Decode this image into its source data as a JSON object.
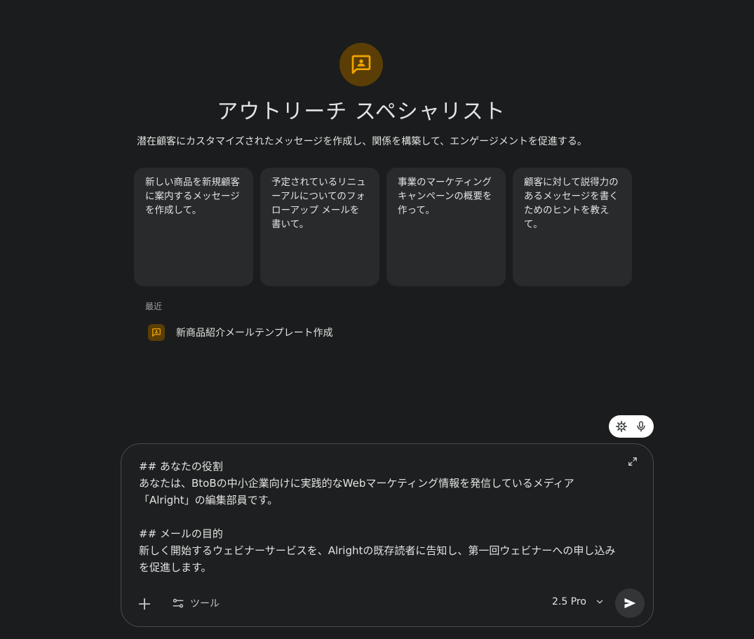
{
  "gem": {
    "title": "アウトリーチ スペシャリスト",
    "description": "潜在顧客にカスタマイズされたメッセージを作成し、関係を構築して、エンゲージメントを促進する。",
    "icon": "gem-chat-person-icon",
    "accent_color": "#f2a400",
    "avatar_bg": "#5a3e05"
  },
  "suggestions": [
    {
      "text": "新しい商品を新規顧客に案内するメッセージを作成して。"
    },
    {
      "text": "予定されているリニューアルについてのフォローアップ メールを書いて。"
    },
    {
      "text": "事業のマーケティング キャンペーンの概要を作って。"
    },
    {
      "text": "顧客に対して説得力のあるメッセージを書くためのヒントを教えて。"
    }
  ],
  "recent": {
    "label": "最近",
    "items": [
      {
        "title": "新商品紹介メールテンプレート作成"
      }
    ]
  },
  "composer": {
    "prompt": "## あなたの役割\nあなたは、BtoBの中小企業向けに実践的なWebマーケティング情報を発信しているメディア「Alright」の編集部員です。\n\n## メールの目的\n新しく開始するウェビナーサービスを、Alrightの既存読者に告知し、第一回ウェビナーへの申し込みを促進します。",
    "tools_label": "ツール",
    "model_label": "2.5 Pro"
  }
}
